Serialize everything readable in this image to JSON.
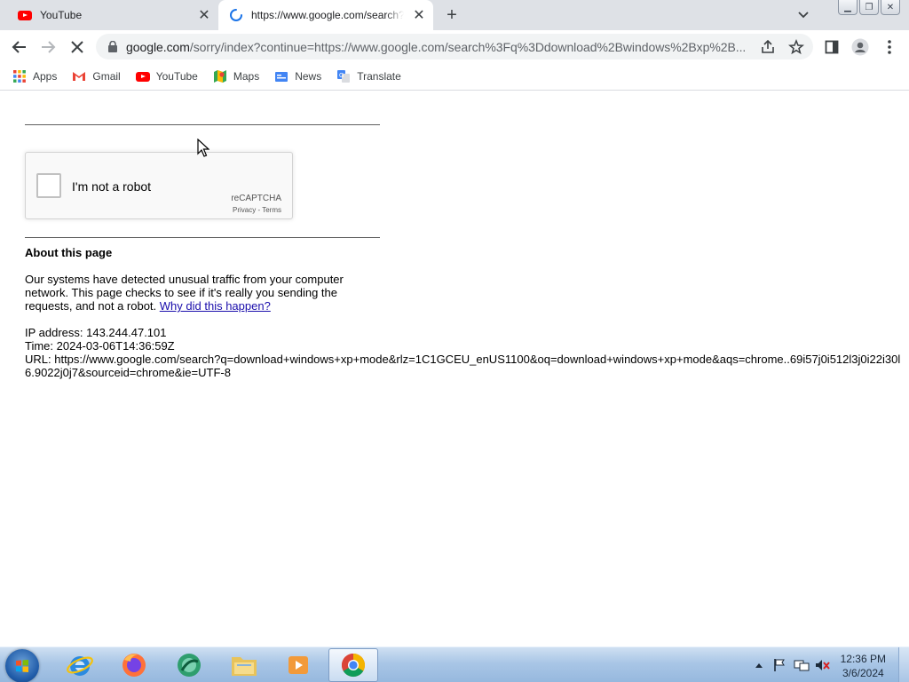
{
  "browser": {
    "tabs": [
      {
        "title": "YouTube",
        "favicon": "youtube-icon"
      },
      {
        "title": "https://www.google.com/search?",
        "favicon": "loading-spinner-icon",
        "active": true
      }
    ],
    "url_host": "google.com",
    "url_rest": "/sorry/index?continue=https://www.google.com/search%3Fq%3Ddownload%2Bwindows%2Bxp%2B...",
    "bookmarks": [
      {
        "label": "Apps",
        "icon": "apps-grid-icon"
      },
      {
        "label": "Gmail",
        "icon": "gmail-icon"
      },
      {
        "label": "YouTube",
        "icon": "youtube-icon"
      },
      {
        "label": "Maps",
        "icon": "maps-icon"
      },
      {
        "label": "News",
        "icon": "news-icon"
      },
      {
        "label": "Translate",
        "icon": "translate-icon"
      }
    ]
  },
  "page": {
    "recaptcha": {
      "label": "I'm not a robot",
      "brand": "reCAPTCHA",
      "privacy": "Privacy",
      "separator": " - ",
      "terms": "Terms"
    },
    "about_title": "About this page",
    "paragraph_text": "Our systems have detected unusual traffic from your computer network. This page checks to see if it's really you sending the requests, and not a robot. ",
    "paragraph_link": "Why did this happen?",
    "ip_line": "IP address: 143.244.47.101",
    "time_line": "Time: 2024-03-06T14:36:59Z",
    "url_line": "URL: https://www.google.com/search?q=download+windows+xp+mode&rlz=1C1GCEU_enUS1100&oq=download+windows+xp+mode&aqs=chrome..69i57j0i512l3j0i22i30l6.9022j0j7&sourceid=chrome&ie=UTF-8"
  },
  "taskbar": {
    "apps": [
      "internet-explorer-icon",
      "firefox-icon",
      "app-icon",
      "file-explorer-icon",
      "media-player-icon",
      "chrome-icon"
    ],
    "time": "12:36 PM",
    "date": "3/6/2024"
  },
  "colors": {
    "link": "#1a0dab",
    "tabstrip": "#dee1e6",
    "omnibox": "#f1f3f4"
  }
}
